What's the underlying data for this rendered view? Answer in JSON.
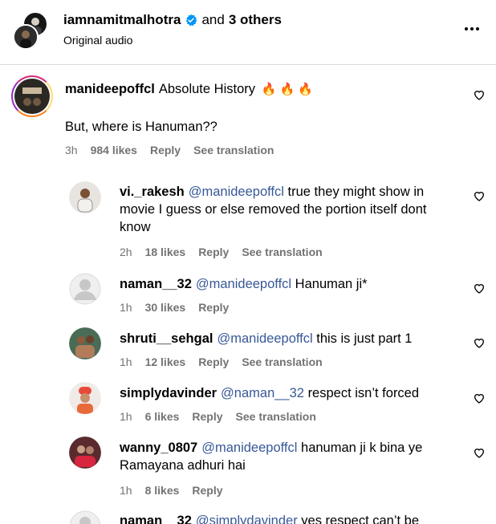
{
  "header": {
    "username": "iamnamitmalhotra",
    "and_text": "and",
    "others": "3 others",
    "subtitle": "Original audio"
  },
  "main_comment": {
    "username": "manideepoffcl",
    "text": "Absolute History",
    "emoji": "🔥 🔥 🔥",
    "second_line": "But, where is Hanuman??",
    "time": "3h",
    "likes": "984 likes",
    "reply": "Reply",
    "translate": "See translation"
  },
  "replies": [
    {
      "username": "vi._rakesh",
      "mention": "@manideepoffcl",
      "text": "true they might show in movie I guess or else removed the portion itself dont know",
      "time": "2h",
      "likes": "18 likes",
      "reply": "Reply",
      "translate": "See translation"
    },
    {
      "username": "naman__32",
      "mention": "@manideepoffcl",
      "text": "Hanuman ji*",
      "time": "1h",
      "likes": "30 likes",
      "reply": "Reply",
      "translate": ""
    },
    {
      "username": "shruti__sehgal",
      "mention": "@manideepoffcl",
      "text": "this is just part 1",
      "time": "1h",
      "likes": "12 likes",
      "reply": "Reply",
      "translate": "See translation"
    },
    {
      "username": "simplydavinder",
      "mention": "@naman__32",
      "text": "respect isn’t forced",
      "time": "1h",
      "likes": "6 likes",
      "reply": "Reply",
      "translate": "See translation"
    },
    {
      "username": "wanny_0807",
      "mention": "@manideepoffcl",
      "text": "hanuman ji k bina ye Ramayana adhuri hai",
      "time": "1h",
      "likes": "8 likes",
      "reply": "Reply",
      "translate": ""
    },
    {
      "username": "naman__32",
      "mention": "@simplydavinder",
      "text": "yes respect can’t be",
      "time": "",
      "likes": "",
      "reply": "",
      "translate": ""
    }
  ],
  "colors": {
    "mention": "#385898",
    "meta": "#737373",
    "verified": "#0095f6"
  },
  "icons": {
    "verified": "verified-badge-icon",
    "more": "more-options-icon",
    "like": "heart-icon"
  }
}
